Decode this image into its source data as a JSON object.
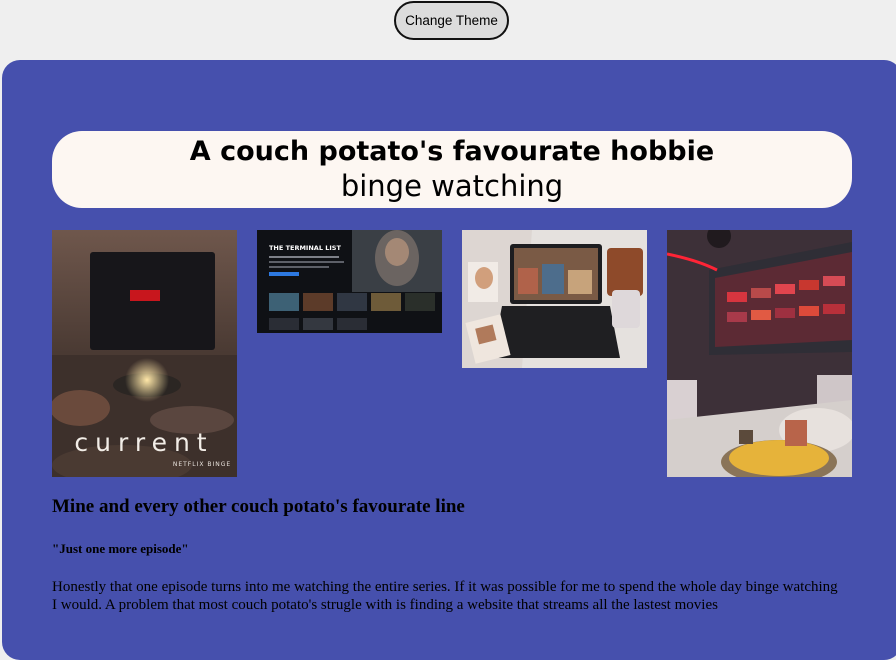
{
  "toolbar": {
    "theme_button_label": "Change Theme"
  },
  "header": {
    "title_line1": "A couch potato's favourate hobbie",
    "title_line2": "binge watching"
  },
  "gallery": {
    "image1_caption": "current",
    "image1_sub": "NETFLIX BINGE",
    "image2_show": "THE TERMINAL LIST"
  },
  "content": {
    "subheading": "Mine and every other couch potato's favourate line",
    "quote": "\"Just one more episode\"",
    "paragraph": "Honestly that one episode turns into me watching the entire series. If it was possible for me to spend the whole day binge watching I would. A problem that most couch potato's strugle with is finding a website that streams all the lastest movies"
  },
  "colors": {
    "panel": "#4650ad",
    "title_bg": "#fdf7f2",
    "page_bg": "#efefef"
  }
}
